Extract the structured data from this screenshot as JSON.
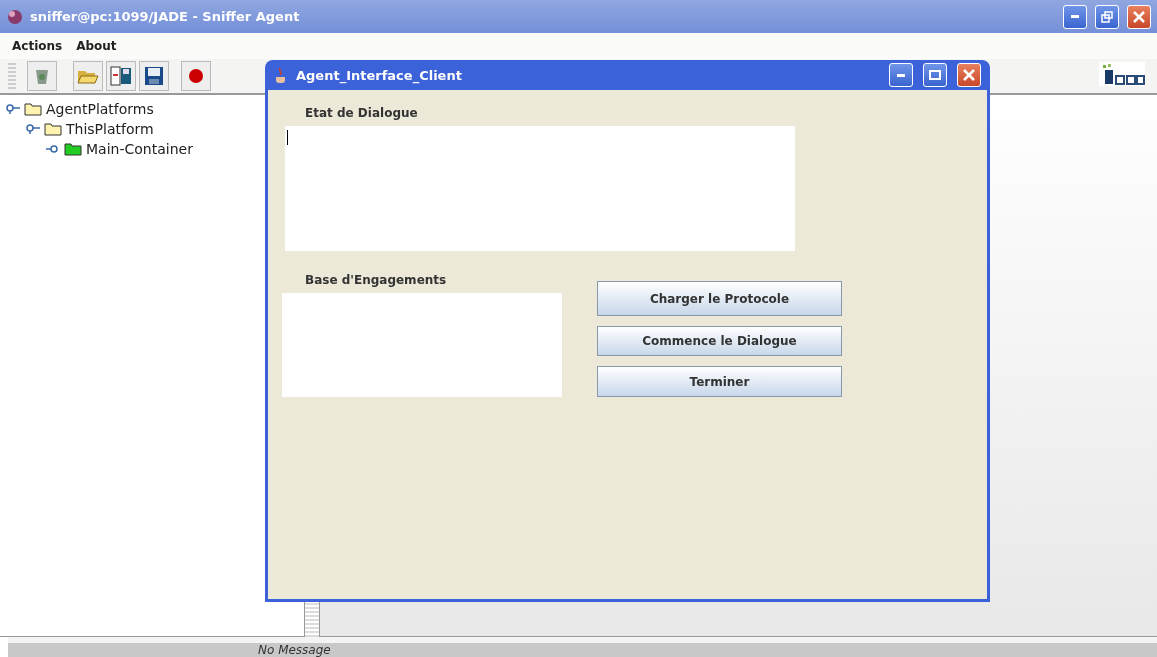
{
  "window": {
    "title": "sniffer@pc:1099/JADE - Sniffer Agent"
  },
  "menu": [
    "Actions",
    "About"
  ],
  "tree": [
    {
      "label": "AgentPlatforms",
      "kind": "folder",
      "children": [
        {
          "label": "ThisPlatform",
          "kind": "folder",
          "children": [
            {
              "label": "Main-Container",
              "kind": "container"
            }
          ]
        }
      ]
    }
  ],
  "status_bar": "No Message",
  "dialog": {
    "title": "Agent_Interface_Client",
    "dialogue_label": "Etat de Dialogue",
    "engagements_label": "Base d'Engagements",
    "buttons": [
      "Charger le Protocole",
      "Commence le Dialogue",
      "Terminer"
    ]
  }
}
